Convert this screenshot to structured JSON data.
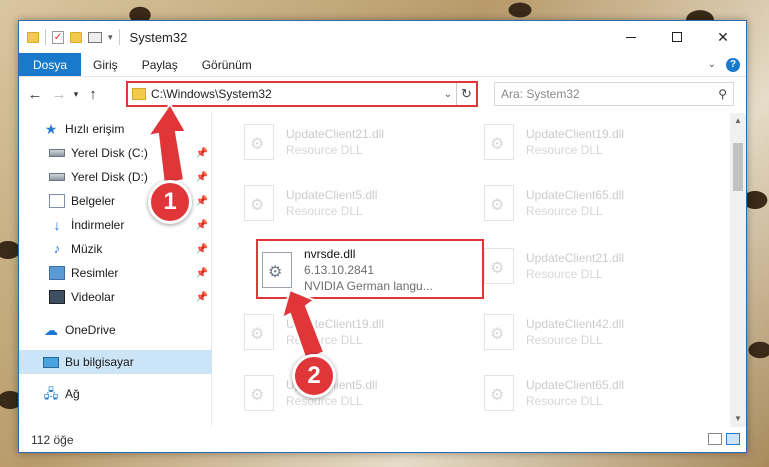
{
  "window": {
    "title": "System32"
  },
  "ribbon": {
    "tabs": [
      {
        "label": "Dosya",
        "active": true
      },
      {
        "label": "Giriş"
      },
      {
        "label": "Paylaş"
      },
      {
        "label": "Görünüm"
      }
    ],
    "help": "?"
  },
  "address": {
    "path": "C:\\Windows\\System32",
    "search_placeholder": "Ara: System32"
  },
  "navpane": {
    "items": [
      {
        "label": "Hızlı erişim",
        "icon": "star-icon"
      },
      {
        "label": "Yerel Disk (C:)",
        "icon": "disk-icon",
        "pinned": true
      },
      {
        "label": "Yerel Disk (D:)",
        "icon": "disk-icon",
        "pinned": true
      },
      {
        "label": "Belgeler",
        "icon": "documents-icon",
        "pinned": true
      },
      {
        "label": "İndirmeler",
        "icon": "downloads-icon",
        "pinned": true
      },
      {
        "label": "Müzik",
        "icon": "music-icon",
        "pinned": true
      },
      {
        "label": "Resimler",
        "icon": "pictures-icon",
        "pinned": true
      },
      {
        "label": "Videolar",
        "icon": "videos-icon",
        "pinned": true
      },
      {
        "label": "OneDrive",
        "icon": "onedrive-icon"
      },
      {
        "label": "Bu bilgisayar",
        "icon": "this-pc-icon",
        "selected": true
      },
      {
        "label": "Ağ",
        "icon": "network-icon"
      }
    ]
  },
  "files": [
    {
      "name": "UpdateClient21.dll",
      "sub": "Resource DLL"
    },
    {
      "name": "UpdateClient19.dll",
      "sub": "Resource DLL"
    },
    {
      "name": "UpdateClient5.dll",
      "sub": "Resource DLL"
    },
    {
      "name": "UpdateClient65.dll",
      "sub": "Resource DLL"
    },
    {
      "name": "nvrsde.dll",
      "sub": "6.13.10.2841",
      "sub2": "NVIDIA German langu...",
      "highlighted": true
    },
    {
      "name": "UpdateClient21.dll",
      "sub": "Resource DLL"
    },
    {
      "name": "UpdateClient19.dll",
      "sub": "Resource DLL"
    },
    {
      "name": "UpdateClient42.dll",
      "sub": "Resource DLL"
    },
    {
      "name": "UpdateClient5.dll",
      "sub": "Resource DLL"
    },
    {
      "name": "UpdateClient65.dll",
      "sub": "Resource DLL"
    }
  ],
  "status": {
    "count": "112 öğe"
  },
  "callouts": [
    "1",
    "2"
  ],
  "colors": {
    "accent": "#1979ca",
    "highlight": "#e0363a",
    "selection": "#cce4f7"
  }
}
